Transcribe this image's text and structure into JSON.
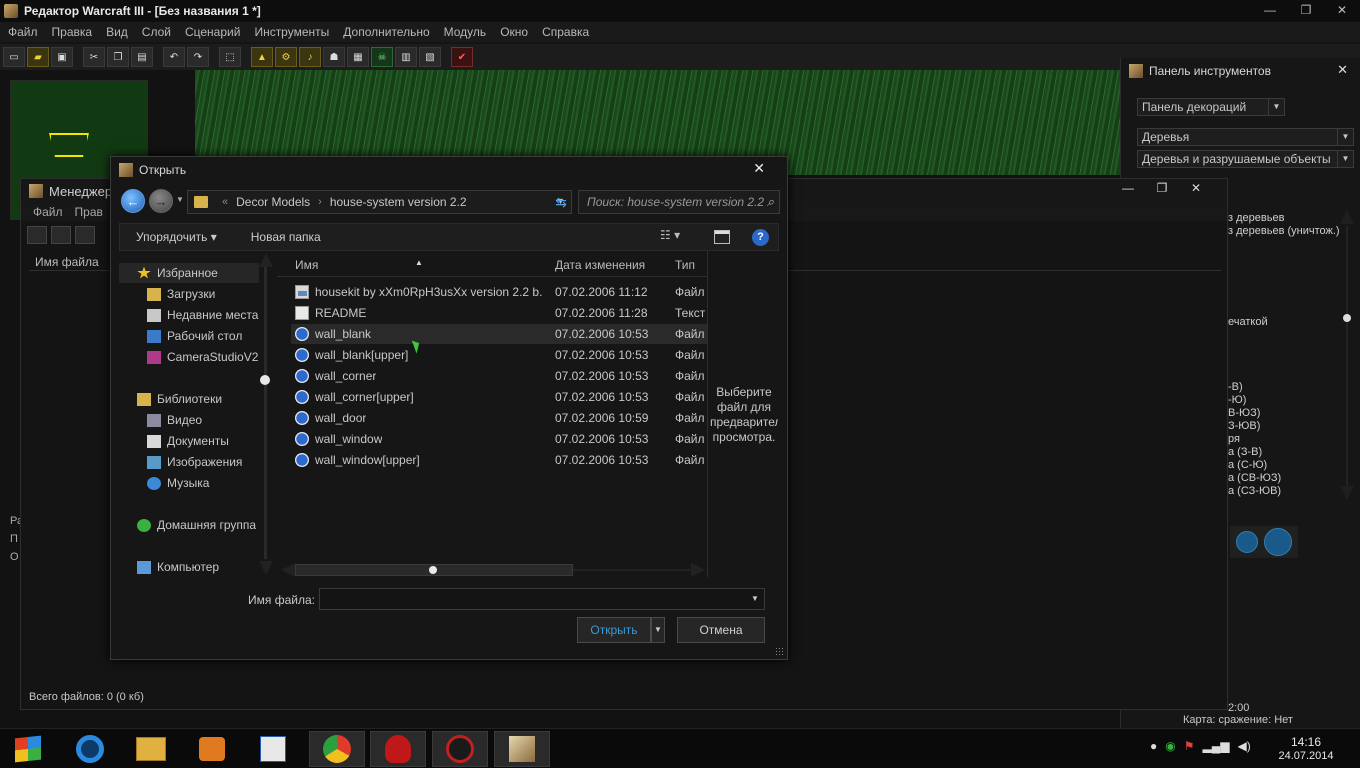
{
  "editor": {
    "title": "Редактор Warcraft III  - [Без названия 1 *]",
    "controls": {
      "minimize": "—",
      "restore": "❐",
      "close": "✕"
    },
    "menu": [
      "Файл",
      "Правка",
      "Вид",
      "Слой",
      "Сценарий",
      "Инструменты",
      "Дополнительно",
      "Модуль",
      "Окно",
      "Справка"
    ],
    "left_labels": [
      "Ра",
      "П",
      "О"
    ],
    "status_time": "2:00",
    "status_map": "Карта: сражение: Нет"
  },
  "palette": {
    "title": "Панель инструментов",
    "close": "✕",
    "panel_select": "Панель декораций",
    "category_select": "Деревья",
    "subcategory_select": "Деревья и разрушаемые объекты",
    "list_top": [
      "з деревьев",
      "з деревьев (уничтож.)"
    ],
    "list_mid": "ечаткой",
    "list_bottom": [
      "-В)",
      "-Ю)",
      "В-ЮЗ)",
      "З-ЮВ)",
      "ря",
      "а (З-В)",
      "а (С-Ю)",
      "а (СВ-ЮЗ)",
      "а (СЗ-ЮВ)"
    ]
  },
  "manager": {
    "title": "Менеджер",
    "menu": [
      "Файл",
      "Прав"
    ],
    "column": "Имя файла",
    "status": "Всего файлов: 0 (0 кб)",
    "controls": {
      "minimize": "—",
      "restore": "❐",
      "close": "✕"
    }
  },
  "dialog": {
    "title": "Открыть",
    "close": "✕",
    "address": {
      "chevron": "«",
      "crumbs": [
        "Decor Models",
        "house-system version 2.2"
      ],
      "separator": "›"
    },
    "search_placeholder": "Поиск: house-system version 2.2",
    "commands": {
      "organize": "Упорядочить ▾",
      "new_folder": "Новая папка",
      "view": "☷ ▾"
    },
    "help": "?",
    "nav": [
      {
        "label": "Избранное",
        "kind": "group",
        "icon": "star-icon",
        "color": "#f0c020"
      },
      {
        "label": "Загрузки",
        "kind": "child",
        "icon": "downloads-icon",
        "color": "#d8b24a"
      },
      {
        "label": "Недавние места",
        "kind": "child",
        "icon": "recent-places-icon",
        "color": "#c8c8c8"
      },
      {
        "label": "Рабочий стол",
        "kind": "child",
        "icon": "desktop-icon",
        "color": "#3a7ac8"
      },
      {
        "label": "CameraStudioV2",
        "kind": "child",
        "icon": "archive-icon",
        "color": "#b03a8a"
      },
      {
        "label": "Библиотеки",
        "kind": "group",
        "icon": "libraries-icon",
        "color": "#d8b24a"
      },
      {
        "label": "Видео",
        "kind": "child",
        "icon": "video-icon",
        "color": "#8a8aa0"
      },
      {
        "label": "Документы",
        "kind": "child",
        "icon": "documents-icon",
        "color": "#d8d8d8"
      },
      {
        "label": "Изображения",
        "kind": "child",
        "icon": "pictures-icon",
        "color": "#5a9ac8"
      },
      {
        "label": "Музыка",
        "kind": "child",
        "icon": "music-icon",
        "color": "#3a8ad8"
      },
      {
        "label": "Домашняя группа",
        "kind": "group",
        "icon": "homegroup-icon",
        "color": "#3ab040"
      },
      {
        "label": "Компьютер",
        "kind": "group",
        "icon": "computer-icon",
        "color": "#5a9ad8"
      }
    ],
    "columns": {
      "name": "Имя",
      "date": "Дата изменения",
      "type": "Тип"
    },
    "files": [
      {
        "name": "housekit by xXm0RpH3usXx version 2.2 b...",
        "date": "07.02.2006 11:12",
        "type": "Файл",
        "icon": "image-file-icon"
      },
      {
        "name": "README",
        "date": "07.02.2006 11:28",
        "type": "Текст",
        "icon": "text-file-icon"
      },
      {
        "name": "wall_blank",
        "date": "07.02.2006 10:53",
        "type": "Файл",
        "icon": "model-file-icon"
      },
      {
        "name": "wall_blank[upper]",
        "date": "07.02.2006 10:53",
        "type": "Файл",
        "icon": "model-file-icon"
      },
      {
        "name": "wall_corner",
        "date": "07.02.2006 10:53",
        "type": "Файл",
        "icon": "model-file-icon"
      },
      {
        "name": "wall_corner[upper]",
        "date": "07.02.2006 10:53",
        "type": "Файл",
        "icon": "model-file-icon"
      },
      {
        "name": "wall_door",
        "date": "07.02.2006 10:59",
        "type": "Файл",
        "icon": "model-file-icon"
      },
      {
        "name": "wall_window",
        "date": "07.02.2006 10:53",
        "type": "Файл",
        "icon": "model-file-icon"
      },
      {
        "name": "wall_window[upper]",
        "date": "07.02.2006 10:53",
        "type": "Файл",
        "icon": "model-file-icon"
      }
    ],
    "hover_index": 2,
    "preview_text": "Выберите\nфайл для\nпредварительн\nпросмотра.",
    "filename_label": "Имя файла:",
    "filename_value": "",
    "open_label": "Открыть",
    "cancel_label": "Отмена"
  },
  "taskbar": {
    "clock_time": "14:16",
    "clock_date": "24.07.2014"
  }
}
